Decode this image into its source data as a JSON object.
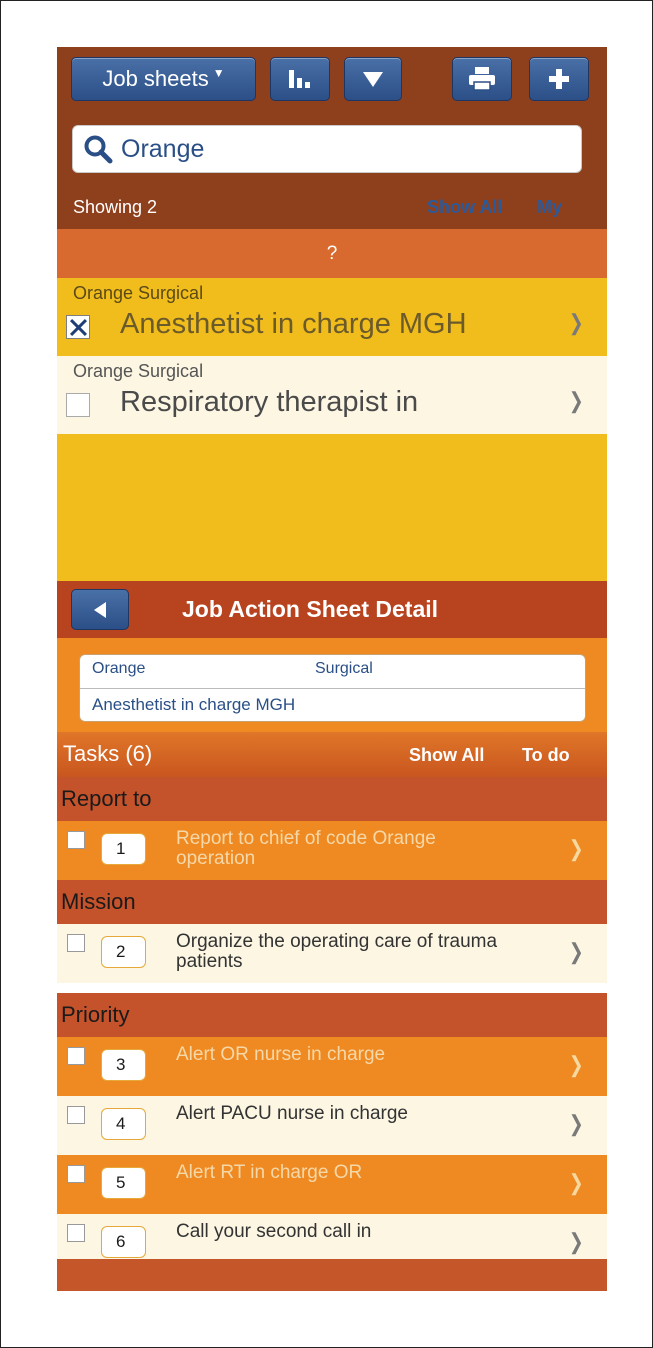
{
  "toolbar": {
    "job_sheets_label": "Job sheets",
    "caret": "▼",
    "filter_glyph": "▼",
    "add_glyph": "+"
  },
  "search": {
    "value": "Orange",
    "showing": "Showing 2",
    "show_all": "Show All",
    "my": "My"
  },
  "group_header": "?",
  "list": [
    {
      "category": "Orange Surgical",
      "title": "Anesthetist in charge MGH",
      "checked": true
    },
    {
      "category": "Orange Surgical",
      "title": "Respiratory therapist in",
      "checked": false
    }
  ],
  "detail": {
    "title": "Job Action Sheet Detail",
    "info_a": "Orange",
    "info_b": "Surgical",
    "info_title": "Anesthetist in charge MGH"
  },
  "tasks": {
    "label": "Tasks (6)",
    "show_all": "Show All",
    "todo": "To do",
    "sections": [
      {
        "name": "Report to"
      },
      {
        "name": "Mission"
      },
      {
        "name": "Priority"
      }
    ],
    "items": [
      {
        "num": "1",
        "text": "Report to chief of code Orange operation"
      },
      {
        "num": "2",
        "text": "Organize the operating care of trauma patients"
      },
      {
        "num": "3",
        "text": "Alert OR nurse in charge"
      },
      {
        "num": "4",
        "text": "Alert PACU nurse in charge"
      },
      {
        "num": "5",
        "text": "Alert RT in charge OR"
      },
      {
        "num": "6",
        "text": "Call your second call in"
      }
    ]
  },
  "chevron": "❯",
  "colors": {
    "toolbar_bg": "#8e3f1c",
    "button_blue": "#2b4f86",
    "accent_orange": "#ef8a23",
    "section_bg": "#c4522a",
    "list_yellow": "#f0bd1c"
  }
}
